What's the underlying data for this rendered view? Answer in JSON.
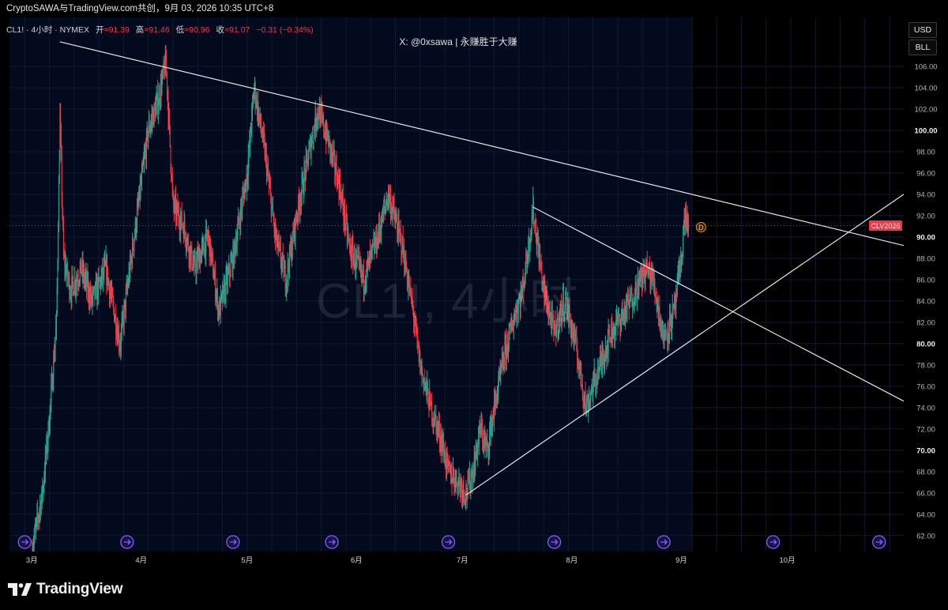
{
  "header": {
    "publish_line": "CryptoSAWA与TradingView.com共创，9月 03, 2026 10:35 UTC+8"
  },
  "legend": {
    "symbol": "CL1! · 4小时 · NYMEX",
    "open_label": "开",
    "open_value": "=91.39",
    "high_label": "高",
    "high_value": "=91.46",
    "low_label": "低",
    "low_value": "=90.96",
    "close_label": "收",
    "close_value": "=91.07",
    "change": "−0.31 (−0.34%)"
  },
  "watermark": {
    "author_line": "X: @0xsawa | 永赚胜于大赚",
    "big_text": "CL1!, 4小时"
  },
  "currency_buttons": {
    "usd": "USD",
    "bll": "BLL"
  },
  "price_tag": {
    "label": "CLV2026",
    "color": "#f23645"
  },
  "event_marker": {
    "label": "D",
    "color": "#ff9800"
  },
  "colors": {
    "up": "#22ab94",
    "down": "#f23645",
    "trendline": "#e6e6e6",
    "event_icon": "#7b61ff"
  },
  "footer": {
    "brand": "TradingView"
  },
  "chart_data": {
    "type": "candlestick",
    "symbol": "CL1!",
    "interval": "4小时",
    "exchange": "NYMEX",
    "ylim": [
      60.5,
      110
    ],
    "yticks": [
      62,
      64,
      66,
      68,
      70,
      72,
      74,
      76,
      78,
      80,
      82,
      84,
      86,
      88,
      90,
      92,
      94,
      96,
      98,
      100,
      102,
      104,
      106
    ],
    "ytick_labels": [
      "62.00",
      "64.00",
      "66.00",
      "68.00",
      "70.00",
      "72.00",
      "74.00",
      "76.00",
      "78.00",
      "80.00",
      "82.00",
      "84.00",
      "86.00",
      "88.00",
      "90.00",
      "92.00",
      "94.00",
      "96.00",
      "98.00",
      "100.00",
      "102.00",
      "104.00",
      "106.00"
    ],
    "x_start": "2026-02-20",
    "x_end": "2026-11-03",
    "xticks": [
      {
        "date": "2026-03-01",
        "label": "3月"
      },
      {
        "date": "2026-04-01",
        "label": "4月"
      },
      {
        "date": "2026-05-01",
        "label": "5月"
      },
      {
        "date": "2026-06-01",
        "label": "6月"
      },
      {
        "date": "2026-07-01",
        "label": "7月"
      },
      {
        "date": "2026-08-01",
        "label": "8月"
      },
      {
        "date": "2026-09-01",
        "label": "9月"
      },
      {
        "date": "2026-10-01",
        "label": "10月"
      }
    ],
    "last_price": 91.07,
    "last_date": "2026-09-03",
    "price_path": [
      [
        "2026-03-01",
        60.5
      ],
      [
        "2026-03-04",
        66
      ],
      [
        "2026-03-06",
        73
      ],
      [
        "2026-03-08",
        82
      ],
      [
        "2026-03-09",
        101
      ],
      [
        "2026-03-10",
        88
      ],
      [
        "2026-03-12",
        85
      ],
      [
        "2026-03-15",
        87
      ],
      [
        "2026-03-18",
        84
      ],
      [
        "2026-03-22",
        87
      ],
      [
        "2026-03-26",
        80
      ],
      [
        "2026-03-30",
        90
      ],
      [
        "2026-04-03",
        100
      ],
      [
        "2026-04-06",
        103
      ],
      [
        "2026-04-08",
        106.5
      ],
      [
        "2026-04-10",
        93
      ],
      [
        "2026-04-13",
        91
      ],
      [
        "2026-04-16",
        87
      ],
      [
        "2026-04-20",
        90
      ],
      [
        "2026-04-23",
        83
      ],
      [
        "2026-04-27",
        88
      ],
      [
        "2026-05-01",
        96
      ],
      [
        "2026-05-03",
        104
      ],
      [
        "2026-05-06",
        98
      ],
      [
        "2026-05-09",
        90
      ],
      [
        "2026-05-12",
        86
      ],
      [
        "2026-05-15",
        92
      ],
      [
        "2026-05-18",
        97
      ],
      [
        "2026-05-21",
        102
      ],
      [
        "2026-05-24",
        99
      ],
      [
        "2026-05-27",
        95
      ],
      [
        "2026-05-30",
        89
      ],
      [
        "2026-06-03",
        86
      ],
      [
        "2026-06-07",
        90
      ],
      [
        "2026-06-10",
        94
      ],
      [
        "2026-06-14",
        89
      ],
      [
        "2026-06-17",
        83
      ],
      [
        "2026-06-19",
        78
      ],
      [
        "2026-06-22",
        74
      ],
      [
        "2026-06-25",
        71
      ],
      [
        "2026-06-27",
        68
      ],
      [
        "2026-06-30",
        67
      ],
      [
        "2026-07-02",
        66
      ],
      [
        "2026-07-04",
        68
      ],
      [
        "2026-07-06",
        72
      ],
      [
        "2026-07-08",
        70
      ],
      [
        "2026-07-10",
        74
      ],
      [
        "2026-07-13",
        79
      ],
      [
        "2026-07-16",
        83
      ],
      [
        "2026-07-18",
        85
      ],
      [
        "2026-07-21",
        92.5
      ],
      [
        "2026-07-24",
        85
      ],
      [
        "2026-07-27",
        81
      ],
      [
        "2026-07-30",
        84
      ],
      [
        "2026-08-02",
        80
      ],
      [
        "2026-08-05",
        74
      ],
      [
        "2026-08-09",
        78
      ],
      [
        "2026-08-12",
        81
      ],
      [
        "2026-08-16",
        83
      ],
      [
        "2026-08-19",
        85
      ],
      [
        "2026-08-22",
        87
      ],
      [
        "2026-08-24",
        86
      ],
      [
        "2026-08-27",
        80.5
      ],
      [
        "2026-08-30",
        83
      ],
      [
        "2026-09-01",
        88
      ],
      [
        "2026-09-02",
        92
      ],
      [
        "2026-09-03",
        91.07
      ]
    ],
    "trendlines": [
      {
        "name": "upper-resistance",
        "from": [
          "2026-03-09",
          108.3
        ],
        "to": [
          "2026-11-03",
          89.2
        ]
      },
      {
        "name": "inner-resistance",
        "from": [
          "2026-07-21",
          92.8
        ],
        "to": [
          "2026-11-03",
          74.6
        ]
      },
      {
        "name": "support",
        "from": [
          "2026-07-02",
          65.8
        ],
        "to": [
          "2026-11-03",
          94.0
        ]
      }
    ],
    "event_markers": [
      "2026-02-27",
      "2026-03-28",
      "2026-04-27",
      "2026-05-25",
      "2026-06-27",
      "2026-07-27",
      "2026-08-27",
      "2026-09-27",
      "2026-10-27"
    ],
    "grid": true,
    "future_region_from": "2026-09-04"
  }
}
